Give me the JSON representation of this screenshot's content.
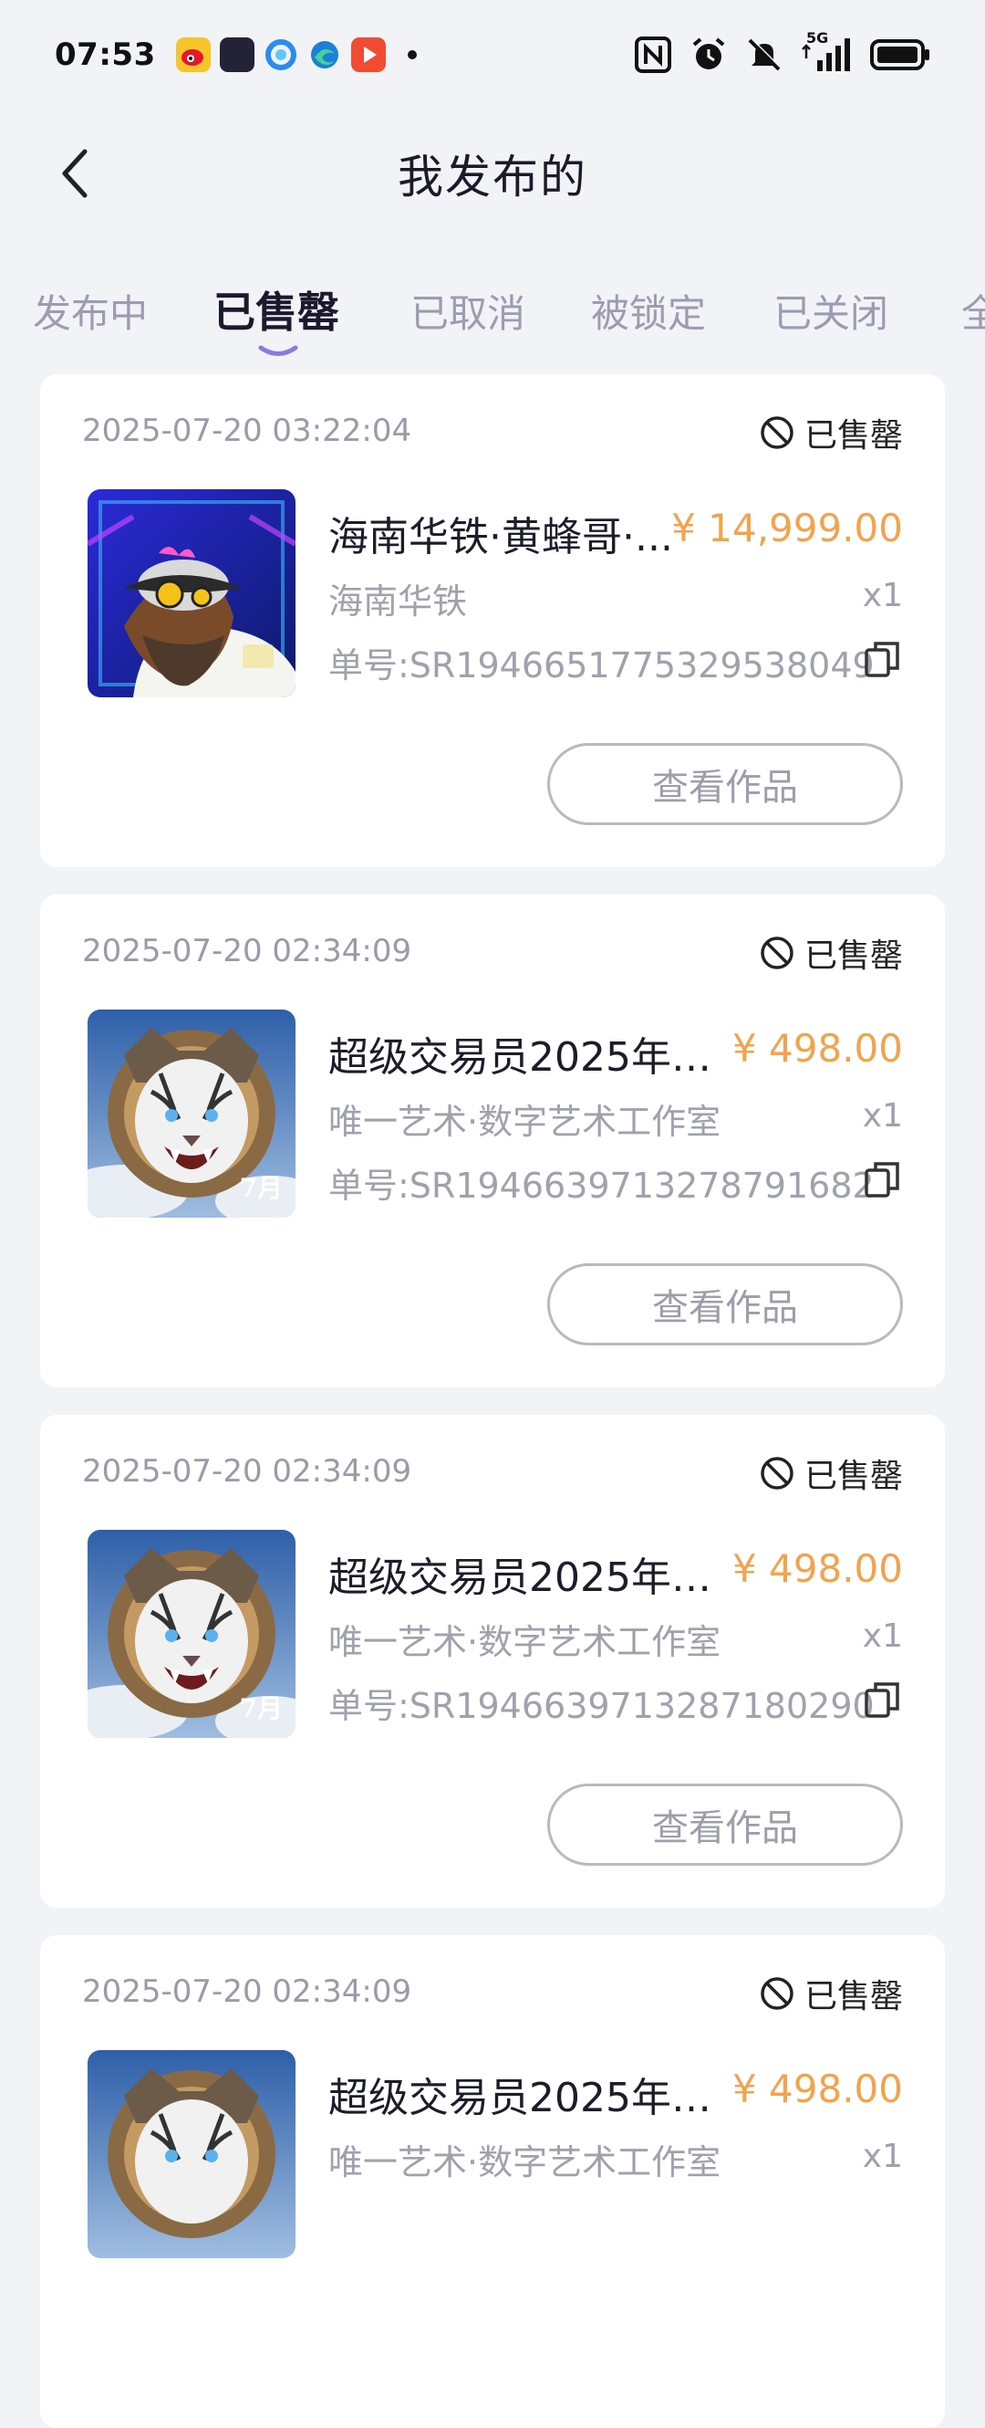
{
  "status_bar": {
    "time": "07:53",
    "network": "5G",
    "app_icons": [
      "weibo-icon",
      "app-icon",
      "browser-icon",
      "edge-icon",
      "video-icon"
    ],
    "right_icons": [
      "nfc-icon",
      "alarm-icon",
      "mute-icon",
      "signal-icon",
      "battery-icon"
    ]
  },
  "header": {
    "title": "我发布的"
  },
  "tabs": [
    {
      "label": "发布中"
    },
    {
      "label": "已售罄"
    },
    {
      "label": "已取消"
    },
    {
      "label": "被锁定"
    },
    {
      "label": "已关闭"
    },
    {
      "label": "全"
    }
  ],
  "active_tab_index": 1,
  "colors": {
    "accent": "#8a7ae0",
    "price": "#f3a34b",
    "background": "#f2f3f7"
  },
  "orders": [
    {
      "date": "2025-07-20 03:22:04",
      "status": "已售罄",
      "title": "海南华铁·黄蜂哥·...",
      "price": "¥ 14,999.00",
      "publisher": "海南华铁",
      "qty": "x1",
      "order_no": "单号:SR1946651775329538049",
      "button": "查看作品",
      "image": "hornet-man-avatar"
    },
    {
      "date": "2025-07-20 02:34:09",
      "status": "已售罄",
      "title": "超级交易员2025年7...",
      "price": "¥ 498.00",
      "publisher": "唯一艺术·数字艺术工作室",
      "qty": "x1",
      "order_no": "单号:SR1946639713278791682",
      "button": "查看作品",
      "image": "white-tiger-badge",
      "image_label": "7月"
    },
    {
      "date": "2025-07-20 02:34:09",
      "status": "已售罄",
      "title": "超级交易员2025年7...",
      "price": "¥ 498.00",
      "publisher": "唯一艺术·数字艺术工作室",
      "qty": "x1",
      "order_no": "单号:SR1946639713287180290",
      "button": "查看作品",
      "image": "white-tiger-badge",
      "image_label": "7月"
    },
    {
      "date": "2025-07-20 02:34:09",
      "status": "已售罄",
      "title": "超级交易员2025年7...",
      "price": "¥ 498.00",
      "publisher": "唯一艺术·数字艺术工作室",
      "qty": "x1",
      "image": "white-tiger-badge"
    }
  ]
}
